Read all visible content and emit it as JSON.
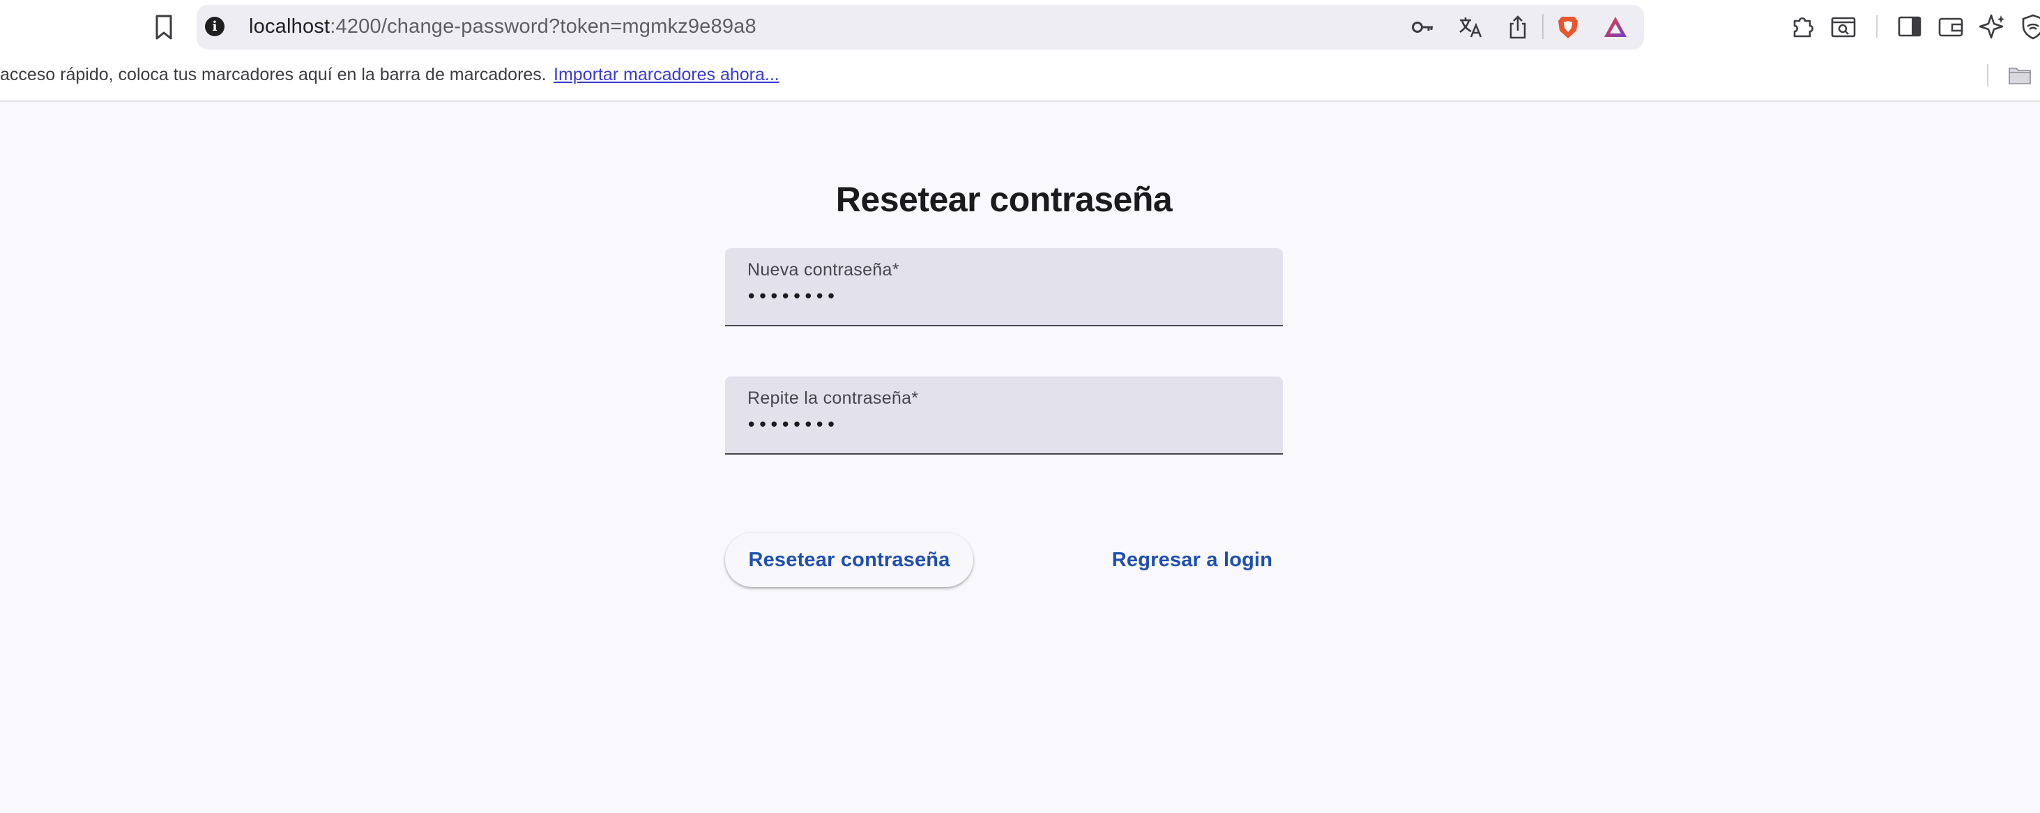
{
  "browser": {
    "url_host": "localhost",
    "url_rest": ":4200/change-password?token=mgmkz9e89a8",
    "icons": {
      "bookmark": "bookmark-icon",
      "site_info": "info-icon",
      "password_key": "key-icon",
      "translate": "translate-icon",
      "share": "share-icon",
      "brave_shields": "brave-lion-icon",
      "brave_rewards": "brave-rewards-triangle-icon",
      "extensions": "puzzle-icon",
      "tab_search": "tab-search-icon",
      "sidebar": "sidebar-icon",
      "wallet": "wallet-icon",
      "leo_ai": "sparkle-icon",
      "vpn": "vpn-icon",
      "folder": "folder-icon"
    },
    "bookmarks_bar": {
      "hint": "acceso rápido, coloca tus marcadores aquí en la barra de marcadores.",
      "import_link": "Importar marcadores ahora..."
    }
  },
  "page": {
    "title": "Resetear contraseña",
    "fields": [
      {
        "label": "Nueva contraseña*",
        "value": "••••••••"
      },
      {
        "label": "Repite la contraseña*",
        "value": "••••••••"
      }
    ],
    "submit_label": "Resetear contraseña",
    "back_label": "Regresar a login"
  },
  "colors": {
    "background": "#f9f8fd",
    "field_background": "#e2e1ec",
    "accent": "#1f4fb0",
    "link": "#3a3ad6"
  }
}
